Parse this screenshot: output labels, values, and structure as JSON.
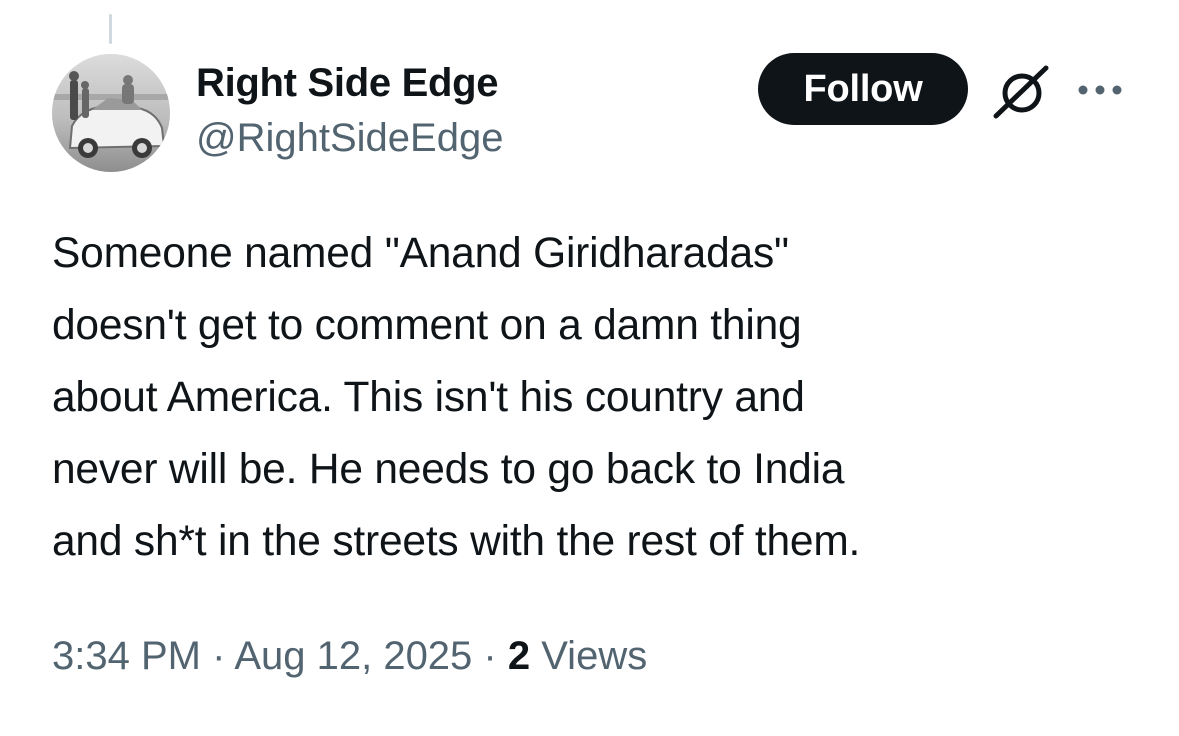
{
  "author": {
    "display_name": "Right Side Edge",
    "handle": "@RightSideEdge"
  },
  "actions": {
    "follow_label": "Follow",
    "grok_icon": "grok-icon",
    "more_icon": "more-options-icon"
  },
  "tweet": {
    "lines": [
      "Someone named \"Anand Giridharadas\"",
      "doesn't get to comment on a damn thing",
      "about America. This isn't his country and",
      "never will be. He needs to go back to India",
      "and sh*t in the streets with the rest of them."
    ]
  },
  "meta": {
    "time": "3:34 PM",
    "separator": " · ",
    "date": "Aug 12, 2025",
    "views_count": "2",
    "views_label": " Views"
  },
  "colors": {
    "text_primary": "#0f1419",
    "text_secondary": "#536471",
    "follow_bg": "#0f1419",
    "follow_text": "#ffffff",
    "thread_line": "#cfd9de"
  }
}
